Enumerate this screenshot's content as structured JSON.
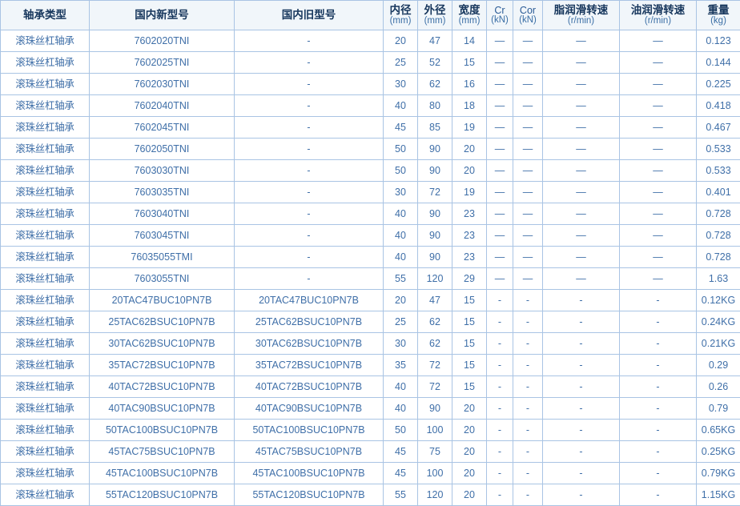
{
  "table": {
    "headers": [
      {
        "key": "type",
        "main": "轴承类型",
        "unit": "",
        "latin": false
      },
      {
        "key": "new",
        "main": "国内新型号",
        "unit": "",
        "latin": false
      },
      {
        "key": "old",
        "main": "国内旧型号",
        "unit": "",
        "latin": false
      },
      {
        "key": "bore",
        "main": "内径",
        "unit": "(mm)",
        "latin": false
      },
      {
        "key": "od",
        "main": "外径",
        "unit": "(mm)",
        "latin": false
      },
      {
        "key": "width",
        "main": "宽度",
        "unit": "(mm)",
        "latin": false
      },
      {
        "key": "cr",
        "main": "Cr",
        "unit": "(kN)",
        "latin": true
      },
      {
        "key": "cor",
        "main": "Cor",
        "unit": "(kN)",
        "latin": true
      },
      {
        "key": "grease",
        "main": "脂润滑转速",
        "unit": "(r/min)",
        "latin": false
      },
      {
        "key": "oil",
        "main": "油润滑转速",
        "unit": "(r/min)",
        "latin": false
      },
      {
        "key": "weight",
        "main": "重量",
        "unit": "(kg)",
        "latin": false
      }
    ],
    "rows": [
      {
        "type": "滚珠丝杠轴承",
        "new": "7602020TNI",
        "old": "-",
        "bore": "20",
        "od": "47",
        "width": "14",
        "cr": "—",
        "cor": "—",
        "grease": "—",
        "oil": "—",
        "weight": "0.123"
      },
      {
        "type": "滚珠丝杠轴承",
        "new": "7602025TNI",
        "old": "-",
        "bore": "25",
        "od": "52",
        "width": "15",
        "cr": "—",
        "cor": "—",
        "grease": "—",
        "oil": "—",
        "weight": "0.144"
      },
      {
        "type": "滚珠丝杠轴承",
        "new": "7602030TNI",
        "old": "-",
        "bore": "30",
        "od": "62",
        "width": "16",
        "cr": "—",
        "cor": "—",
        "grease": "—",
        "oil": "—",
        "weight": "0.225"
      },
      {
        "type": "滚珠丝杠轴承",
        "new": "7602040TNI",
        "old": "-",
        "bore": "40",
        "od": "80",
        "width": "18",
        "cr": "—",
        "cor": "—",
        "grease": "—",
        "oil": "—",
        "weight": "0.418"
      },
      {
        "type": "滚珠丝杠轴承",
        "new": "7602045TNI",
        "old": "-",
        "bore": "45",
        "od": "85",
        "width": "19",
        "cr": "—",
        "cor": "—",
        "grease": "—",
        "oil": "—",
        "weight": "0.467"
      },
      {
        "type": "滚珠丝杠轴承",
        "new": "7602050TNI",
        "old": "-",
        "bore": "50",
        "od": "90",
        "width": "20",
        "cr": "—",
        "cor": "—",
        "grease": "—",
        "oil": "—",
        "weight": "0.533"
      },
      {
        "type": "滚珠丝杠轴承",
        "new": "7603030TNI",
        "old": "-",
        "bore": "50",
        "od": "90",
        "width": "20",
        "cr": "—",
        "cor": "—",
        "grease": "—",
        "oil": "—",
        "weight": "0.533"
      },
      {
        "type": "滚珠丝杠轴承",
        "new": "7603035TNI",
        "old": "-",
        "bore": "30",
        "od": "72",
        "width": "19",
        "cr": "—",
        "cor": "—",
        "grease": "—",
        "oil": "—",
        "weight": "0.401"
      },
      {
        "type": "滚珠丝杠轴承",
        "new": "7603040TNI",
        "old": "-",
        "bore": "40",
        "od": "90",
        "width": "23",
        "cr": "—",
        "cor": "—",
        "grease": "—",
        "oil": "—",
        "weight": "0.728"
      },
      {
        "type": "滚珠丝杠轴承",
        "new": "7603045TNI",
        "old": "-",
        "bore": "40",
        "od": "90",
        "width": "23",
        "cr": "—",
        "cor": "—",
        "grease": "—",
        "oil": "—",
        "weight": "0.728"
      },
      {
        "type": "滚珠丝杠轴承",
        "new": "76035055TMI",
        "old": "-",
        "bore": "40",
        "od": "90",
        "width": "23",
        "cr": "—",
        "cor": "—",
        "grease": "—",
        "oil": "—",
        "weight": "0.728"
      },
      {
        "type": "滚珠丝杠轴承",
        "new": "7603055TNI",
        "old": "-",
        "bore": "55",
        "od": "120",
        "width": "29",
        "cr": "—",
        "cor": "—",
        "grease": "—",
        "oil": "—",
        "weight": "1.63"
      },
      {
        "type": "滚珠丝杠轴承",
        "new": "20TAC47BUC10PN7B",
        "old": "20TAC47BUC10PN7B",
        "bore": "20",
        "od": "47",
        "width": "15",
        "cr": "-",
        "cor": "-",
        "grease": "-",
        "oil": "-",
        "weight": "0.12KG"
      },
      {
        "type": "滚珠丝杠轴承",
        "new": "25TAC62BSUC10PN7B",
        "old": "25TAC62BSUC10PN7B",
        "bore": "25",
        "od": "62",
        "width": "15",
        "cr": "-",
        "cor": "-",
        "grease": "-",
        "oil": "-",
        "weight": "0.24KG"
      },
      {
        "type": "滚珠丝杠轴承",
        "new": "30TAC62BSUC10PN7B",
        "old": "30TAC62BSUC10PN7B",
        "bore": "30",
        "od": "62",
        "width": "15",
        "cr": "-",
        "cor": "-",
        "grease": "-",
        "oil": "-",
        "weight": "0.21KG"
      },
      {
        "type": "滚珠丝杠轴承",
        "new": "35TAC72BSUC10PN7B",
        "old": "35TAC72BSUC10PN7B",
        "bore": "35",
        "od": "72",
        "width": "15",
        "cr": "-",
        "cor": "-",
        "grease": "-",
        "oil": "-",
        "weight": "0.29"
      },
      {
        "type": "滚珠丝杠轴承",
        "new": "40TAC72BSUC10PN7B",
        "old": "40TAC72BSUC10PN7B",
        "bore": "40",
        "od": "72",
        "width": "15",
        "cr": "-",
        "cor": "-",
        "grease": "-",
        "oil": "-",
        "weight": "0.26"
      },
      {
        "type": "滚珠丝杠轴承",
        "new": "40TAC90BSUC10PN7B",
        "old": "40TAC90BSUC10PN7B",
        "bore": "40",
        "od": "90",
        "width": "20",
        "cr": "-",
        "cor": "-",
        "grease": "-",
        "oil": "-",
        "weight": "0.79"
      },
      {
        "type": "滚珠丝杠轴承",
        "new": "50TAC100BSUC10PN7B",
        "old": "50TAC100BSUC10PN7B",
        "bore": "50",
        "od": "100",
        "width": "20",
        "cr": "-",
        "cor": "-",
        "grease": "-",
        "oil": "-",
        "weight": "0.65KG"
      },
      {
        "type": "滚珠丝杠轴承",
        "new": "45TAC75BSUC10PN7B",
        "old": "45TAC75BSUC10PN7B",
        "bore": "45",
        "od": "75",
        "width": "20",
        "cr": "-",
        "cor": "-",
        "grease": "-",
        "oil": "-",
        "weight": "0.25KG"
      },
      {
        "type": "滚珠丝杠轴承",
        "new": "45TAC100BSUC10PN7B",
        "old": "45TAC100BSUC10PN7B",
        "bore": "45",
        "od": "100",
        "width": "20",
        "cr": "-",
        "cor": "-",
        "grease": "-",
        "oil": "-",
        "weight": "0.79KG"
      },
      {
        "type": "滚珠丝杠轴承",
        "new": "55TAC120BSUC10PN7B",
        "old": "55TAC120BSUC10PN7B",
        "bore": "55",
        "od": "120",
        "width": "20",
        "cr": "-",
        "cor": "-",
        "grease": "-",
        "oil": "-",
        "weight": "1.15KG"
      }
    ]
  },
  "colors": {
    "header_bg": "#f1f6fa",
    "border": "#a9c4e4",
    "header_text": "#16365c",
    "unit_text": "#3a6ea5",
    "type_text": "#1f4e87",
    "value_text": "#4a76ab",
    "dash_text": "#3a3a3a"
  }
}
